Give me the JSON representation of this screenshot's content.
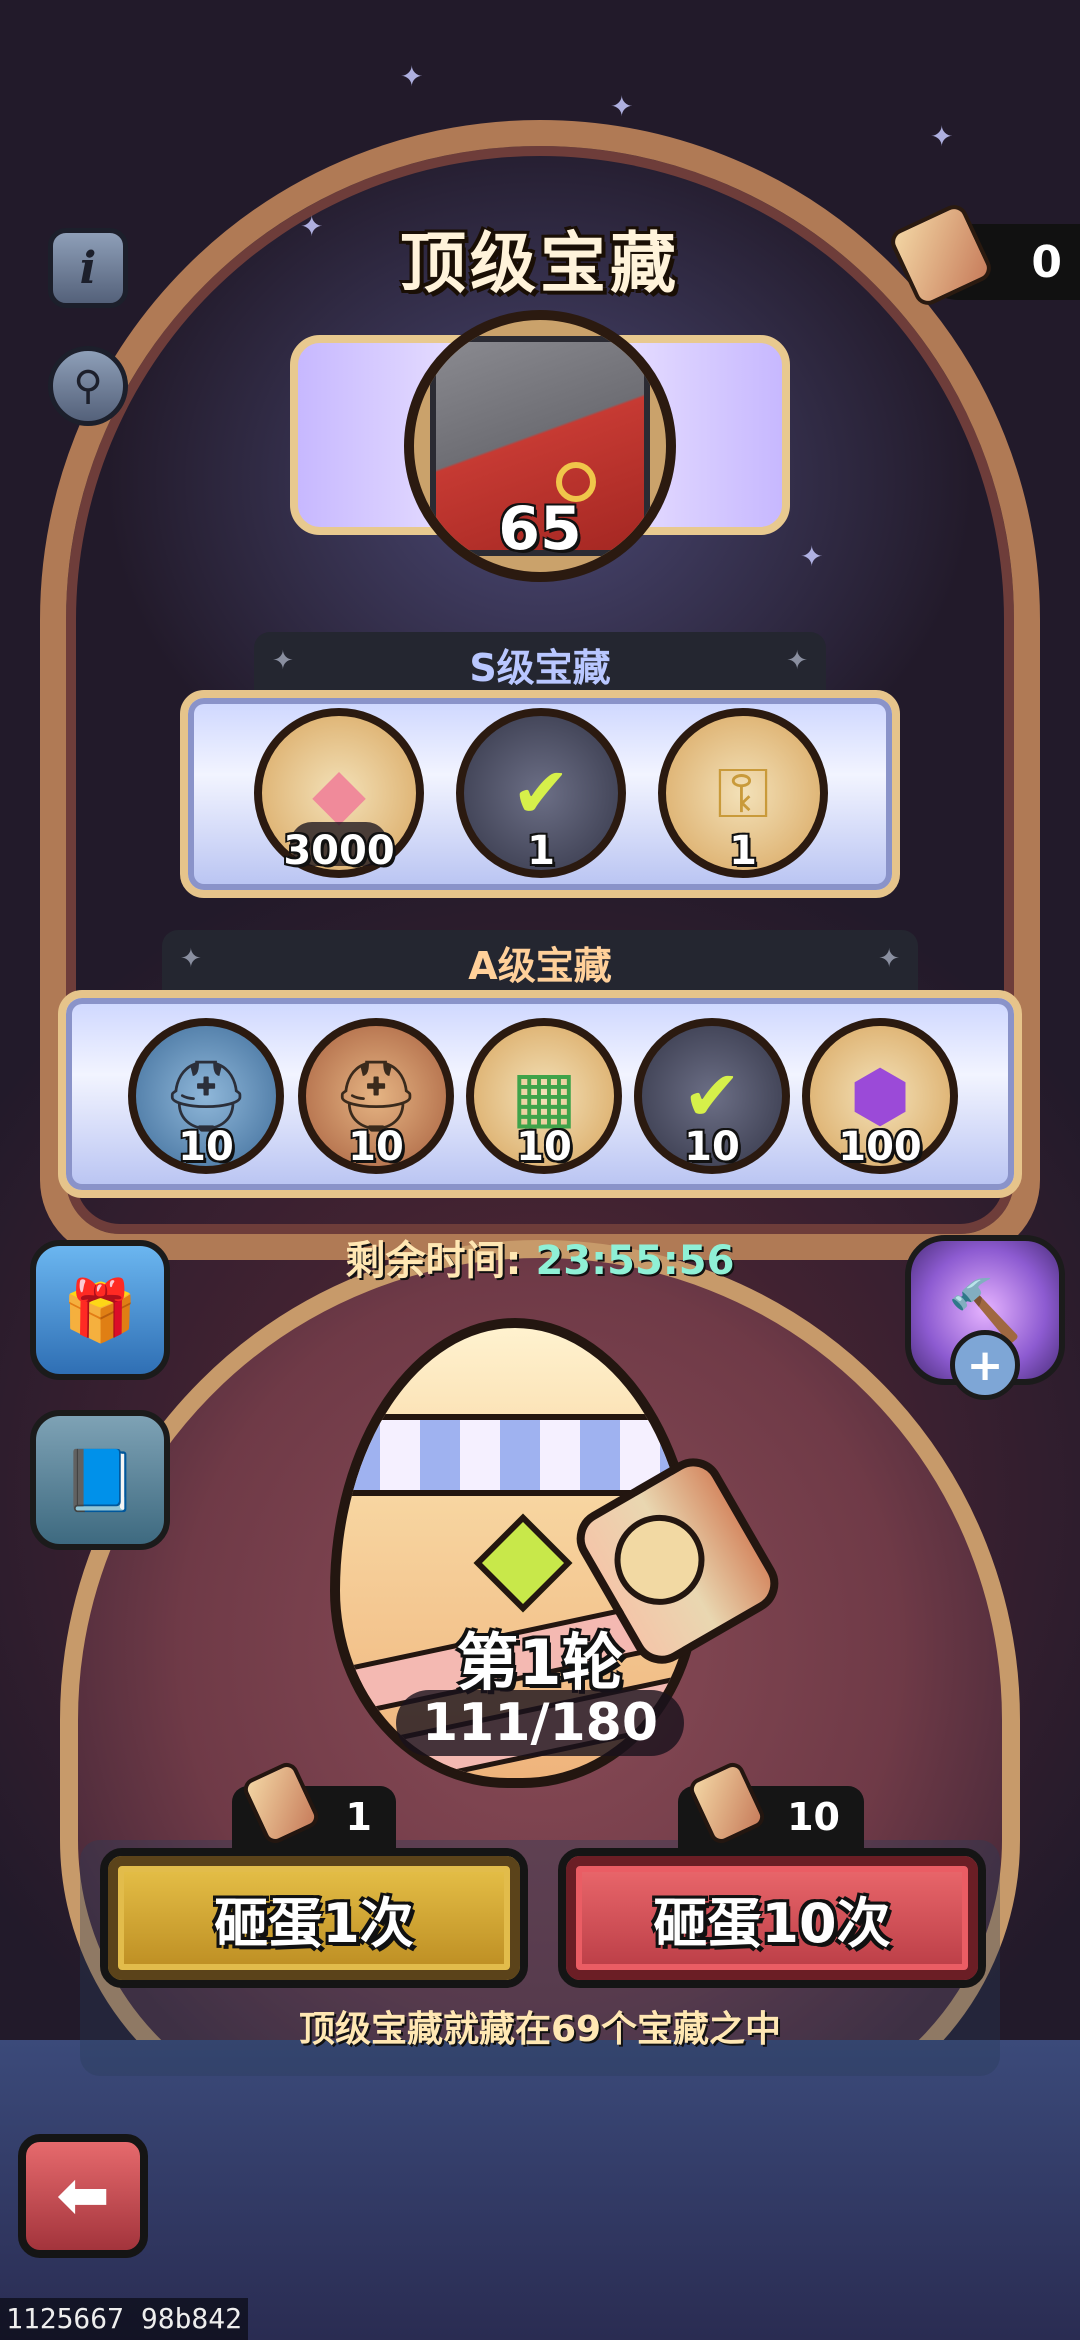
{
  "header": {
    "title": "顶级宝藏",
    "hammer_count": "0"
  },
  "top_prize": {
    "icon": "minotaur-portrait-icon",
    "amount": "65"
  },
  "tier_s": {
    "label": "S级宝藏",
    "rewards": [
      {
        "icon": "gem-icon",
        "amount": "3000"
      },
      {
        "icon": "checkmark-token-icon",
        "amount": "1"
      },
      {
        "icon": "ssr-key-icon",
        "amount": "1"
      }
    ]
  },
  "tier_a": {
    "label": "A级宝藏",
    "rewards": [
      {
        "icon": "helmet-book-icon",
        "amount": "10"
      },
      {
        "icon": "helmet-book-bronze-icon",
        "amount": "10"
      },
      {
        "icon": "color-book-icon",
        "amount": "10"
      },
      {
        "icon": "checkmark-token-icon",
        "amount": "10"
      },
      {
        "icon": "purple-orb-icon",
        "amount": "100"
      }
    ]
  },
  "timer": {
    "label": "剩余时间:",
    "value": "23:55:56"
  },
  "egg": {
    "round_label": "第1轮",
    "progress": "111/180"
  },
  "actions": {
    "smash_once_label": "砸蛋1次",
    "smash_once_cost": "1",
    "smash_ten_label": "砸蛋10次",
    "smash_ten_cost": "10"
  },
  "hint": "顶级宝藏就藏在69个宝藏之中",
  "build_id": "1125667 98b842",
  "colors": {
    "smash_once": "#d4a834",
    "smash_ten": "#d9525a",
    "timer_value": "#8ff0d6"
  }
}
